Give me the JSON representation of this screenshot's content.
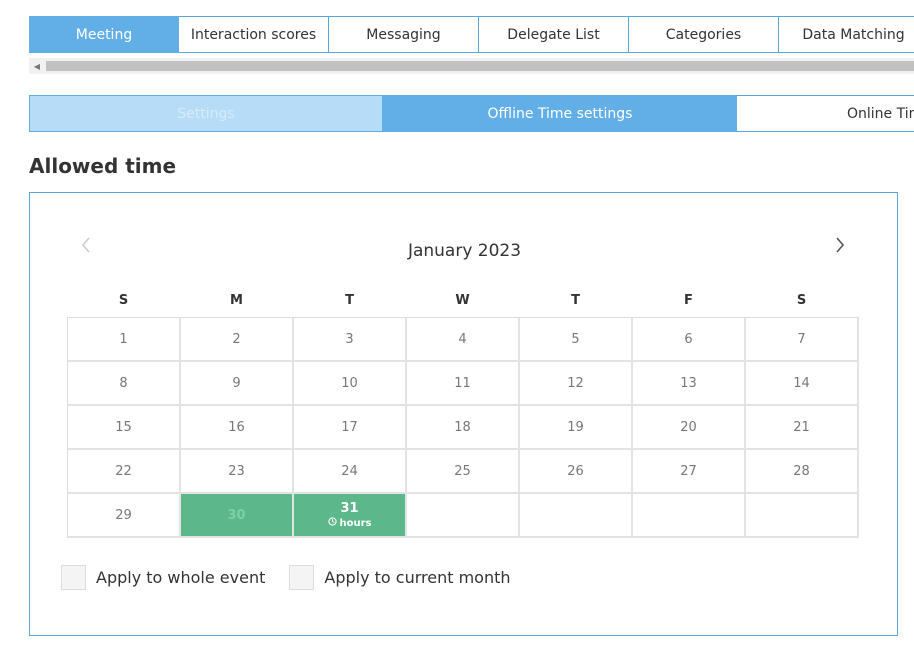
{
  "top_tabs": [
    {
      "label": "Meeting",
      "active": true
    },
    {
      "label": "Interaction scores",
      "active": false
    },
    {
      "label": "Messaging",
      "active": false
    },
    {
      "label": "Delegate List",
      "active": false
    },
    {
      "label": "Categories",
      "active": false
    },
    {
      "label": "Data Matching",
      "active": false
    }
  ],
  "sub_tabs": [
    {
      "label": "Settings",
      "state": "disabled"
    },
    {
      "label": "Offline Time settings",
      "state": "active"
    },
    {
      "label": "Online Tim",
      "state": "plain"
    }
  ],
  "section_title": "Allowed time",
  "calendar": {
    "month_label": "January 2023",
    "prev_icon": "chevron-left-icon",
    "next_icon": "chevron-right-icon",
    "weekdays": [
      "S",
      "M",
      "T",
      "W",
      "T",
      "F",
      "S"
    ],
    "days": [
      "1",
      "2",
      "3",
      "4",
      "5",
      "6",
      "7",
      "8",
      "9",
      "10",
      "11",
      "12",
      "13",
      "14",
      "15",
      "16",
      "17",
      "18",
      "19",
      "20",
      "21",
      "22",
      "23",
      "24",
      "25",
      "26",
      "27",
      "28",
      "29",
      "30",
      "31"
    ],
    "highlighted": {
      "30": "faded",
      "31": "hours"
    },
    "hours_label": "hours",
    "hours_icon": "clock-icon",
    "highlight_color": "#5cb88a"
  },
  "checkboxes": [
    {
      "label": "Apply to whole event",
      "checked": false
    },
    {
      "label": "Apply to current month",
      "checked": false
    }
  ],
  "colors": {
    "accent": "#62aee6",
    "accent_light": "#b6dcf7"
  }
}
